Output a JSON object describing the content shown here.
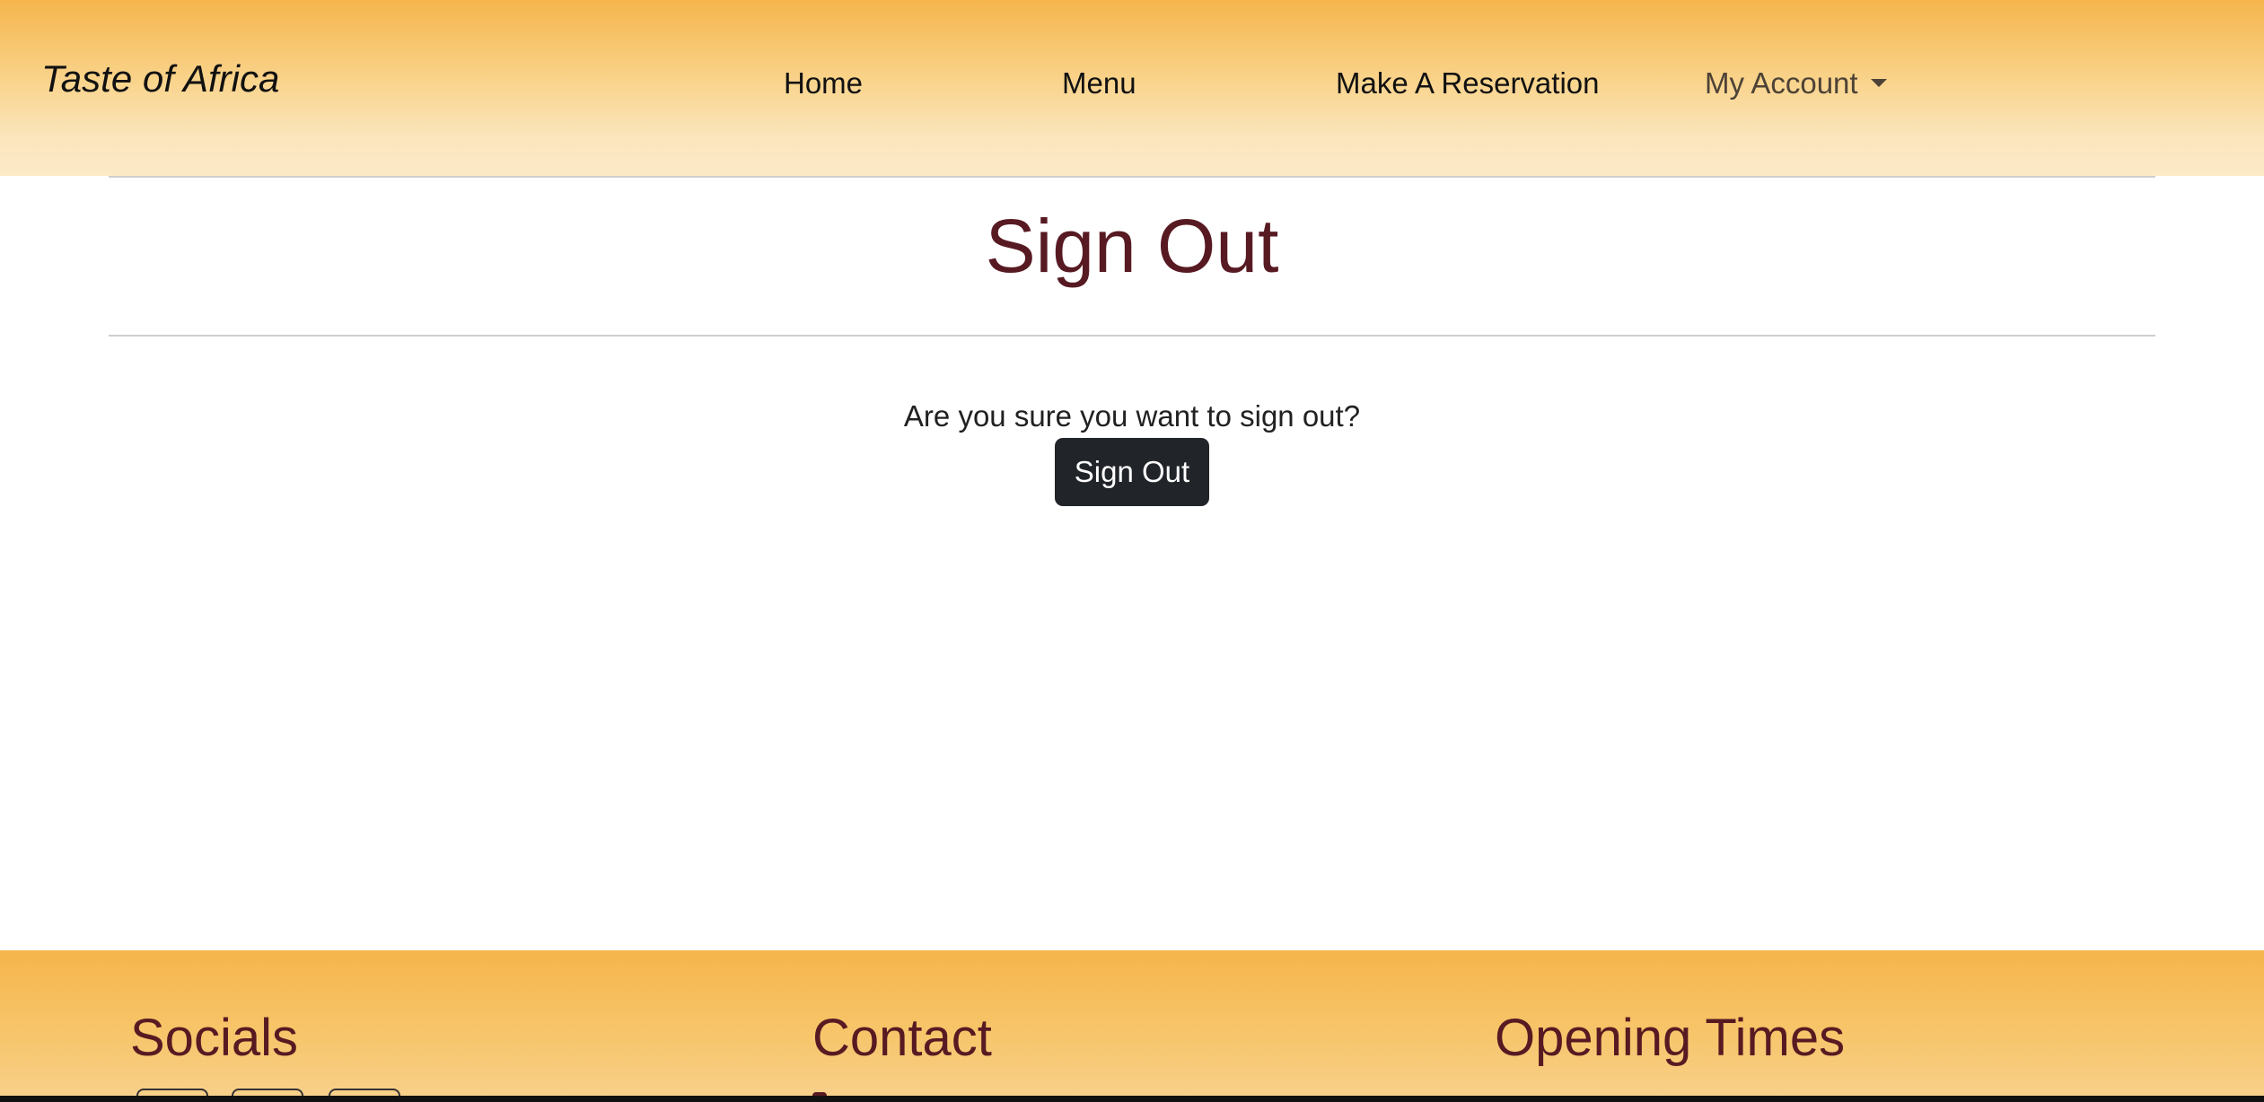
{
  "navbar": {
    "brand": "Taste of Africa",
    "links": [
      {
        "label": "Home"
      },
      {
        "label": "Menu"
      },
      {
        "label": "Make A Reservation"
      }
    ],
    "account_label": "My Account"
  },
  "main": {
    "title": "Sign Out",
    "prompt": "Are you sure you want to sign out?",
    "button_label": "Sign Out"
  },
  "footer": {
    "socials_heading": "Socials",
    "contact_heading": "Contact",
    "hours_heading": "Opening Times"
  },
  "colors": {
    "header_gradient_top": "#f5b54c",
    "header_gradient_bottom": "#fce9c6",
    "title_color": "#581a22",
    "button_bg": "#212529"
  }
}
